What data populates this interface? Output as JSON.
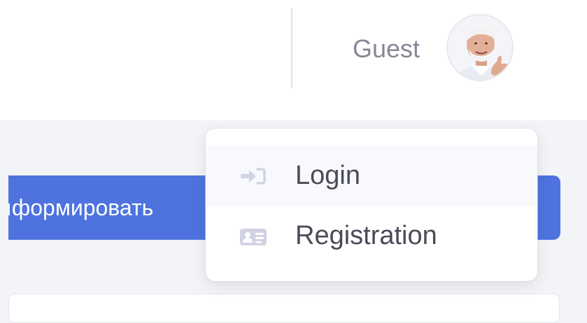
{
  "topbar": {
    "user_name": "Guest",
    "avatar_icon": "user-avatar-photo"
  },
  "content": {
    "primary_button_label": "ıформировать"
  },
  "dropdown": {
    "items": [
      {
        "label": "Login",
        "icon": "sign-in-icon"
      },
      {
        "label": "Registration",
        "icon": "id-card-icon"
      }
    ]
  },
  "colors": {
    "primary": "#4e73df",
    "text_muted": "#858796",
    "icon_muted": "#d1d3e2"
  }
}
